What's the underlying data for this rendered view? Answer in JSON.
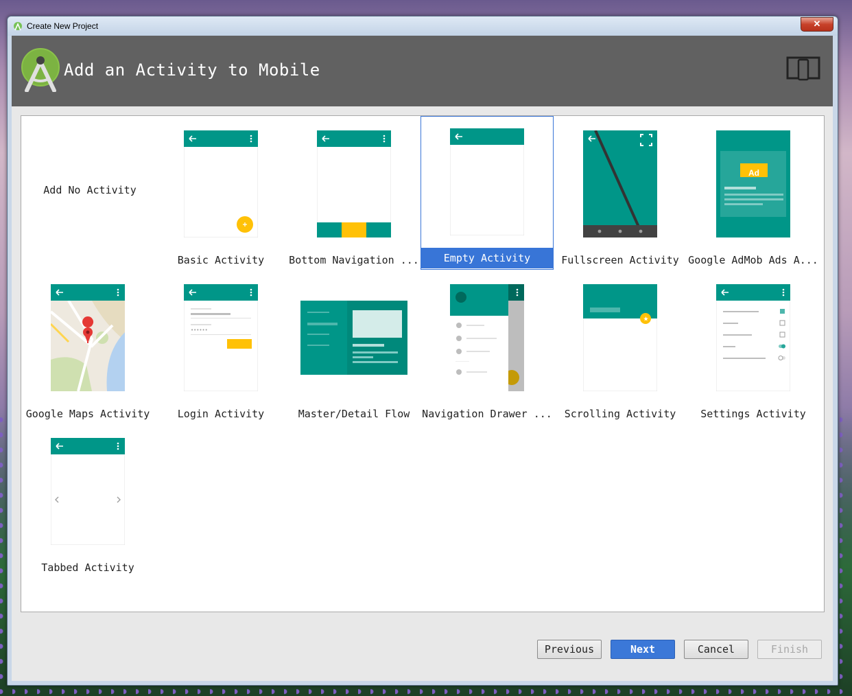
{
  "window": {
    "title": "Create New Project",
    "close_label": "✕"
  },
  "header": {
    "title": "Add an Activity to Mobile"
  },
  "templates": {
    "no_activity": "Add No Activity",
    "basic": "Basic Activity",
    "bottom_nav": "Bottom Navigation ...",
    "empty": "Empty Activity",
    "fullscreen": "Fullscreen Activity",
    "admob": "Google AdMob Ads A...",
    "admob_badge": "Ad",
    "maps": "Google Maps Activity",
    "login": "Login Activity",
    "master_detail": "Master/Detail Flow",
    "nav_drawer": "Navigation Drawer ...",
    "scrolling": "Scrolling Activity",
    "settings": "Settings Activity",
    "tabbed": "Tabbed Activity"
  },
  "selected_template": "Empty Activity",
  "buttons": {
    "previous": "Previous",
    "next": "Next",
    "cancel": "Cancel",
    "finish": "Finish"
  },
  "colors": {
    "teal": "#009688",
    "accent": "#FFC107",
    "header_bg": "#616161",
    "selection": "#3875D7"
  }
}
